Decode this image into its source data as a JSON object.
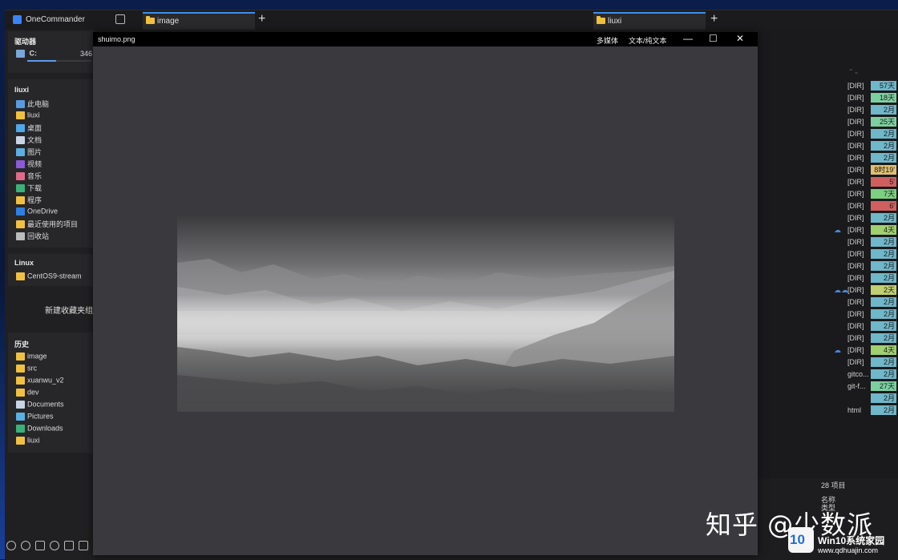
{
  "app": {
    "title": "OneCommander"
  },
  "tabs": {
    "left": "image",
    "right": "liuxi"
  },
  "sidebar": {
    "drives_title": "驱动器",
    "drive": {
      "label": "C:",
      "free": "346",
      "usage_fraction": 0.45
    },
    "liuxi_title": "liuxi",
    "liuxi_items": [
      {
        "label": "此电脑",
        "icon": "computer-icon"
      },
      {
        "label": "liuxi",
        "icon": "folder-icon"
      },
      {
        "label": "桌面",
        "icon": "desktop-icon"
      },
      {
        "label": "文档",
        "icon": "document-icon"
      },
      {
        "label": "图片",
        "icon": "pictures-icon"
      },
      {
        "label": "视频",
        "icon": "video-icon"
      },
      {
        "label": "音乐",
        "icon": "music-icon"
      },
      {
        "label": "下载",
        "icon": "download-icon"
      },
      {
        "label": "程序",
        "icon": "folder-icon"
      },
      {
        "label": "OneDrive",
        "icon": "cloud-icon"
      },
      {
        "label": "最近使用的项目",
        "icon": "folder-icon"
      },
      {
        "label": "回收站",
        "icon": "recycle-bin-icon"
      }
    ],
    "linux_title": "Linux",
    "linux_items": [
      {
        "label": "CentOS9-stream",
        "icon": "folder-icon"
      }
    ],
    "new_favorite_group": "新建收藏夹组",
    "history_title": "历史",
    "history_items": [
      {
        "label": "image",
        "icon": "folder-icon"
      },
      {
        "label": "src",
        "icon": "folder-icon"
      },
      {
        "label": "xuanwu_v2",
        "icon": "folder-icon"
      },
      {
        "label": "dev",
        "icon": "folder-icon"
      },
      {
        "label": "Documents",
        "icon": "document-icon"
      },
      {
        "label": "Pictures",
        "icon": "pictures-icon"
      },
      {
        "label": "Downloads",
        "icon": "download-icon"
      },
      {
        "label": "liuxi",
        "icon": "folder-icon"
      }
    ]
  },
  "viewer": {
    "title": "shuimo.png",
    "mode_media": "多媒体",
    "mode_text": "文本/纯文本",
    "minimize": "—",
    "maximize": "☐",
    "close": "✕"
  },
  "right_panel": {
    "rows": [
      {
        "name": "[DIR]",
        "age": "57天",
        "color": "#6fb7c9"
      },
      {
        "name": "[DIR]",
        "age": "18天",
        "color": "#7cd0a0"
      },
      {
        "name": "[DIR]",
        "age": "2月",
        "color": "#6fb7c9"
      },
      {
        "name": "[DIR]",
        "age": "25天",
        "color": "#7cd0a0"
      },
      {
        "name": "[DIR]",
        "age": "2月",
        "color": "#6fb7c9"
      },
      {
        "name": "[DIR]",
        "age": "2月",
        "color": "#6fb7c9"
      },
      {
        "name": "[DIR]",
        "age": "2月",
        "color": "#6fb7c9"
      },
      {
        "name": "[DIR]",
        "age": "8时19'",
        "color": "#e0c070"
      },
      {
        "name": "[DIR]",
        "age": "5'",
        "color": "#d06060"
      },
      {
        "name": "[DIR]",
        "age": "7天",
        "color": "#7cd080"
      },
      {
        "name": "[DIR]",
        "age": "6'",
        "color": "#d06060"
      },
      {
        "name": "[DIR]",
        "age": "2月",
        "color": "#6fb7c9"
      },
      {
        "name": "[DIR]",
        "age": "4天",
        "color": "#a0d070",
        "cloud": "☁"
      },
      {
        "name": "[DIR]",
        "age": "2月",
        "color": "#6fb7c9"
      },
      {
        "name": "[DIR]",
        "age": "2月",
        "color": "#6fb7c9"
      },
      {
        "name": "[DIR]",
        "age": "2月",
        "color": "#6fb7c9"
      },
      {
        "name": "[DIR]",
        "age": "2月",
        "color": "#6fb7c9"
      },
      {
        "name": "[DIR]",
        "age": "2天",
        "color": "#c0d070",
        "cloud": "☁☁"
      },
      {
        "name": "[DIR]",
        "age": "2月",
        "color": "#6fb7c9"
      },
      {
        "name": "[DIR]",
        "age": "2月",
        "color": "#6fb7c9"
      },
      {
        "name": "[DIR]",
        "age": "2月",
        "color": "#6fb7c9"
      },
      {
        "name": "[DIR]",
        "age": "2月",
        "color": "#6fb7c9"
      },
      {
        "name": "[DIR]",
        "age": "4天",
        "color": "#a0d070",
        "cloud": "☁"
      },
      {
        "name": "[DIR]",
        "age": "2月",
        "color": "#6fb7c9"
      },
      {
        "name": "gitco...",
        "age": "2月",
        "color": "#6fb7c9"
      },
      {
        "name": "git-f...",
        "age": "27天",
        "color": "#7cd0a0"
      },
      {
        "name": "",
        "age": "2月",
        "color": "#6fb7c9"
      },
      {
        "name": "html",
        "age": "2月",
        "color": "#6fb7c9"
      }
    ],
    "item_count": "28 项目",
    "name_label": "名称",
    "type_label": "类型"
  },
  "watermark": {
    "zhihu": "知乎 @少数派",
    "logo": "10",
    "site_name": "Win10系统家园",
    "site_url": "www.qdhuajin.com"
  }
}
